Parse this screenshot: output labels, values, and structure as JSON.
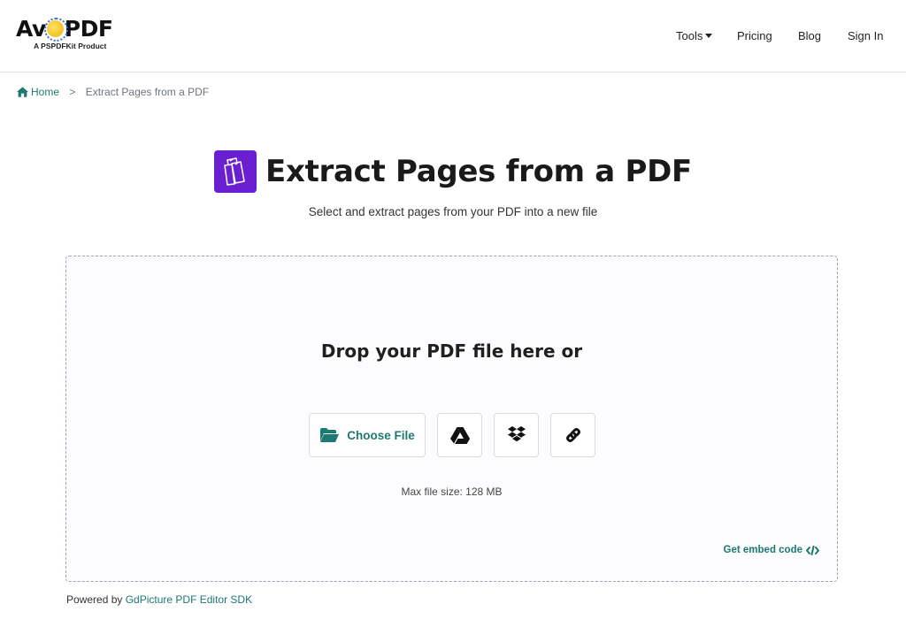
{
  "brand": {
    "name_before": "Av",
    "name_after": "PDF",
    "tagline": "A PSPDFKit Product",
    "accent_color": "#1d7a72",
    "tool_icon_color": "#6a1fd0"
  },
  "nav": {
    "tools": "Tools",
    "pricing": "Pricing",
    "blog": "Blog",
    "sign_in": "Sign In"
  },
  "breadcrumb": {
    "home": "Home",
    "separator": ">",
    "current": "Extract Pages from a PDF"
  },
  "hero": {
    "title": "Extract Pages from a PDF",
    "subtitle": "Select and extract pages from your PDF into a new file",
    "icon": "extract-pages-icon"
  },
  "dropzone": {
    "title": "Drop your PDF file here or",
    "choose_file": "Choose File",
    "max_size": "Max file size: 128 MB",
    "embed": "Get embed code",
    "icons": [
      "folder-open-icon",
      "google-drive-icon",
      "dropbox-icon",
      "link-icon",
      "code-icon"
    ]
  },
  "footer": {
    "powered_prefix": "Powered by",
    "powered_link": "GdPicture PDF Editor SDK"
  }
}
